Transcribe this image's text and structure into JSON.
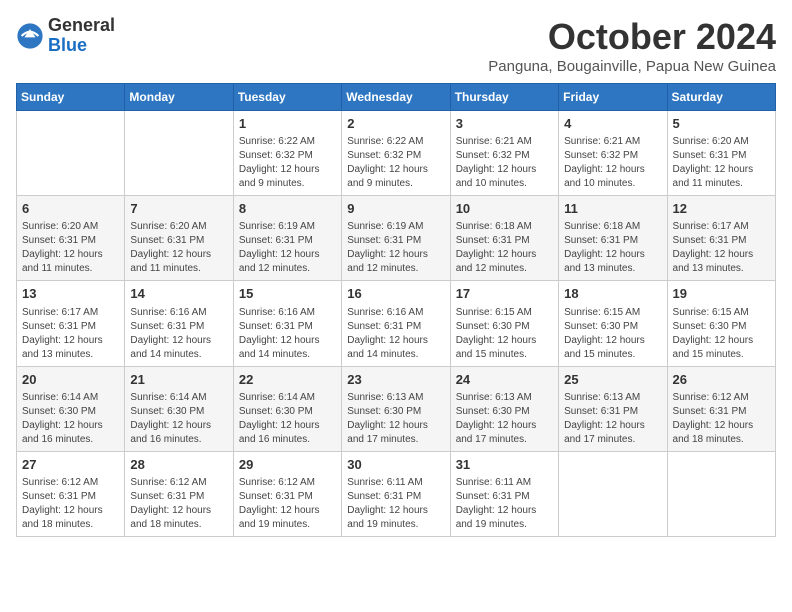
{
  "header": {
    "logo": {
      "general": "General",
      "blue": "Blue"
    },
    "title": "October 2024",
    "location": "Panguna, Bougainville, Papua New Guinea"
  },
  "weekdays": [
    "Sunday",
    "Monday",
    "Tuesday",
    "Wednesday",
    "Thursday",
    "Friday",
    "Saturday"
  ],
  "weeks": [
    [
      {
        "day": "",
        "info": ""
      },
      {
        "day": "",
        "info": ""
      },
      {
        "day": "1",
        "info": "Sunrise: 6:22 AM\nSunset: 6:32 PM\nDaylight: 12 hours and 9 minutes."
      },
      {
        "day": "2",
        "info": "Sunrise: 6:22 AM\nSunset: 6:32 PM\nDaylight: 12 hours and 9 minutes."
      },
      {
        "day": "3",
        "info": "Sunrise: 6:21 AM\nSunset: 6:32 PM\nDaylight: 12 hours and 10 minutes."
      },
      {
        "day": "4",
        "info": "Sunrise: 6:21 AM\nSunset: 6:32 PM\nDaylight: 12 hours and 10 minutes."
      },
      {
        "day": "5",
        "info": "Sunrise: 6:20 AM\nSunset: 6:31 PM\nDaylight: 12 hours and 11 minutes."
      }
    ],
    [
      {
        "day": "6",
        "info": "Sunrise: 6:20 AM\nSunset: 6:31 PM\nDaylight: 12 hours and 11 minutes."
      },
      {
        "day": "7",
        "info": "Sunrise: 6:20 AM\nSunset: 6:31 PM\nDaylight: 12 hours and 11 minutes."
      },
      {
        "day": "8",
        "info": "Sunrise: 6:19 AM\nSunset: 6:31 PM\nDaylight: 12 hours and 12 minutes."
      },
      {
        "day": "9",
        "info": "Sunrise: 6:19 AM\nSunset: 6:31 PM\nDaylight: 12 hours and 12 minutes."
      },
      {
        "day": "10",
        "info": "Sunrise: 6:18 AM\nSunset: 6:31 PM\nDaylight: 12 hours and 12 minutes."
      },
      {
        "day": "11",
        "info": "Sunrise: 6:18 AM\nSunset: 6:31 PM\nDaylight: 12 hours and 13 minutes."
      },
      {
        "day": "12",
        "info": "Sunrise: 6:17 AM\nSunset: 6:31 PM\nDaylight: 12 hours and 13 minutes."
      }
    ],
    [
      {
        "day": "13",
        "info": "Sunrise: 6:17 AM\nSunset: 6:31 PM\nDaylight: 12 hours and 13 minutes."
      },
      {
        "day": "14",
        "info": "Sunrise: 6:16 AM\nSunset: 6:31 PM\nDaylight: 12 hours and 14 minutes."
      },
      {
        "day": "15",
        "info": "Sunrise: 6:16 AM\nSunset: 6:31 PM\nDaylight: 12 hours and 14 minutes."
      },
      {
        "day": "16",
        "info": "Sunrise: 6:16 AM\nSunset: 6:31 PM\nDaylight: 12 hours and 14 minutes."
      },
      {
        "day": "17",
        "info": "Sunrise: 6:15 AM\nSunset: 6:30 PM\nDaylight: 12 hours and 15 minutes."
      },
      {
        "day": "18",
        "info": "Sunrise: 6:15 AM\nSunset: 6:30 PM\nDaylight: 12 hours and 15 minutes."
      },
      {
        "day": "19",
        "info": "Sunrise: 6:15 AM\nSunset: 6:30 PM\nDaylight: 12 hours and 15 minutes."
      }
    ],
    [
      {
        "day": "20",
        "info": "Sunrise: 6:14 AM\nSunset: 6:30 PM\nDaylight: 12 hours and 16 minutes."
      },
      {
        "day": "21",
        "info": "Sunrise: 6:14 AM\nSunset: 6:30 PM\nDaylight: 12 hours and 16 minutes."
      },
      {
        "day": "22",
        "info": "Sunrise: 6:14 AM\nSunset: 6:30 PM\nDaylight: 12 hours and 16 minutes."
      },
      {
        "day": "23",
        "info": "Sunrise: 6:13 AM\nSunset: 6:30 PM\nDaylight: 12 hours and 17 minutes."
      },
      {
        "day": "24",
        "info": "Sunrise: 6:13 AM\nSunset: 6:30 PM\nDaylight: 12 hours and 17 minutes."
      },
      {
        "day": "25",
        "info": "Sunrise: 6:13 AM\nSunset: 6:31 PM\nDaylight: 12 hours and 17 minutes."
      },
      {
        "day": "26",
        "info": "Sunrise: 6:12 AM\nSunset: 6:31 PM\nDaylight: 12 hours and 18 minutes."
      }
    ],
    [
      {
        "day": "27",
        "info": "Sunrise: 6:12 AM\nSunset: 6:31 PM\nDaylight: 12 hours and 18 minutes."
      },
      {
        "day": "28",
        "info": "Sunrise: 6:12 AM\nSunset: 6:31 PM\nDaylight: 12 hours and 18 minutes."
      },
      {
        "day": "29",
        "info": "Sunrise: 6:12 AM\nSunset: 6:31 PM\nDaylight: 12 hours and 19 minutes."
      },
      {
        "day": "30",
        "info": "Sunrise: 6:11 AM\nSunset: 6:31 PM\nDaylight: 12 hours and 19 minutes."
      },
      {
        "day": "31",
        "info": "Sunrise: 6:11 AM\nSunset: 6:31 PM\nDaylight: 12 hours and 19 minutes."
      },
      {
        "day": "",
        "info": ""
      },
      {
        "day": "",
        "info": ""
      }
    ]
  ]
}
